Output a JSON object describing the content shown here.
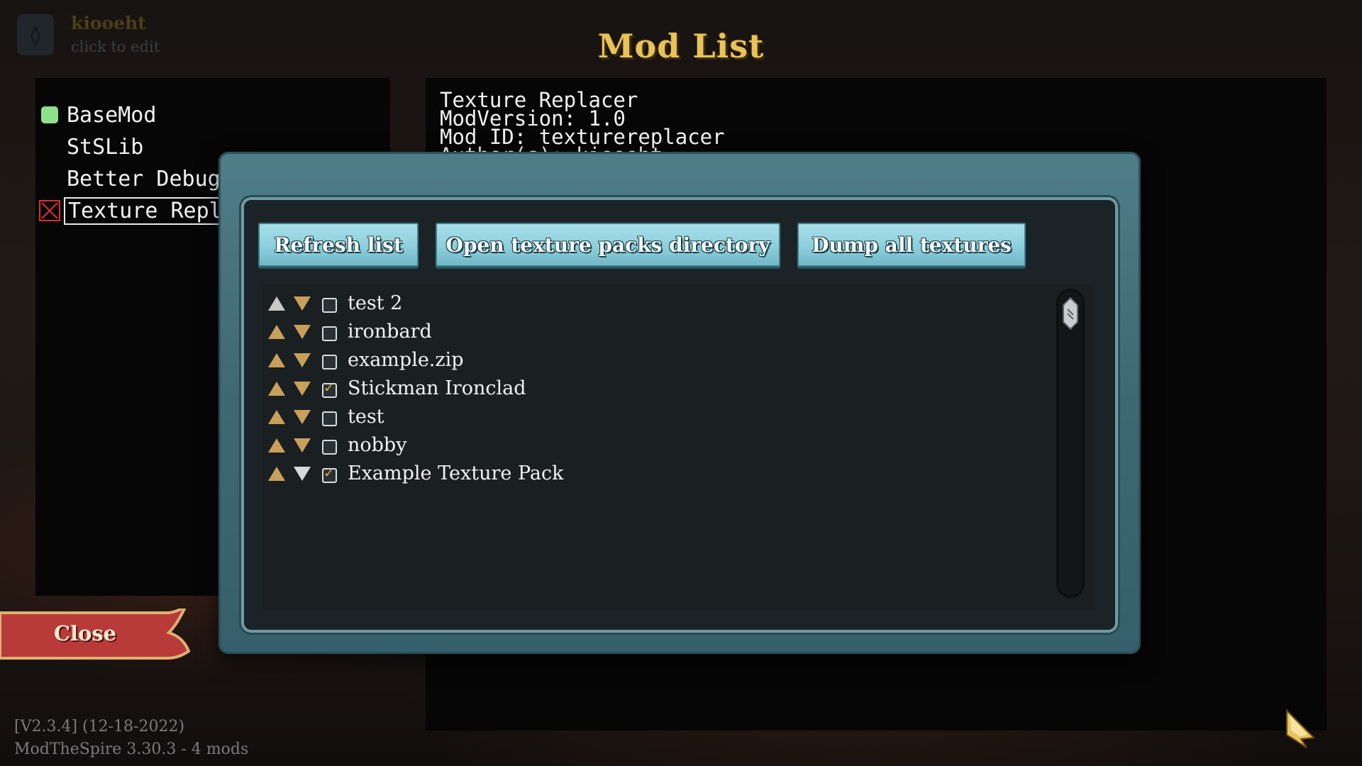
{
  "profile": {
    "name": "kiooeht",
    "subtitle": "click to edit",
    "icon": "rune-icon"
  },
  "title": "Mod List",
  "mods": [
    {
      "label": "BaseMod",
      "status": "enabled"
    },
    {
      "label": "StSLib",
      "status": "none"
    },
    {
      "label": "Better Debug",
      "status": "none"
    },
    {
      "label": "Texture Replacer",
      "status": "error",
      "selected": true
    }
  ],
  "info": {
    "name": "Texture Replacer",
    "version": "ModVersion: 1.0",
    "mod_id": "Mod ID: texturereplacer",
    "author_partial": "Author(s): kiooeht"
  },
  "close_label": "Close",
  "version": {
    "line1": "[V2.3.4] (12-18-2022)",
    "line2": "ModTheSpire 3.30.3 - 4 mods"
  },
  "modal": {
    "buttons": {
      "refresh": "Refresh list",
      "open_dir": "Open texture packs directory",
      "dump": "Dump all textures"
    },
    "packs": [
      {
        "name": "test 2",
        "checked": false,
        "up_enabled": false,
        "down_enabled": true
      },
      {
        "name": "ironbard",
        "checked": false,
        "up_enabled": true,
        "down_enabled": true
      },
      {
        "name": "example.zip",
        "checked": false,
        "up_enabled": true,
        "down_enabled": true
      },
      {
        "name": "Stickman Ironclad",
        "checked": true,
        "up_enabled": true,
        "down_enabled": true
      },
      {
        "name": "test",
        "checked": false,
        "up_enabled": true,
        "down_enabled": true
      },
      {
        "name": "nobby",
        "checked": false,
        "up_enabled": true,
        "down_enabled": true
      },
      {
        "name": "Example Texture Pack",
        "checked": true,
        "up_enabled": true,
        "down_enabled": false
      }
    ]
  },
  "colors": {
    "title": "#e9c35a",
    "enabled_status": "#8fe08a",
    "error_status": "#d93030",
    "button_fill": "#8dcfdc",
    "close_fill": "#b83b3a",
    "arrow_active": "#c9a05a"
  }
}
